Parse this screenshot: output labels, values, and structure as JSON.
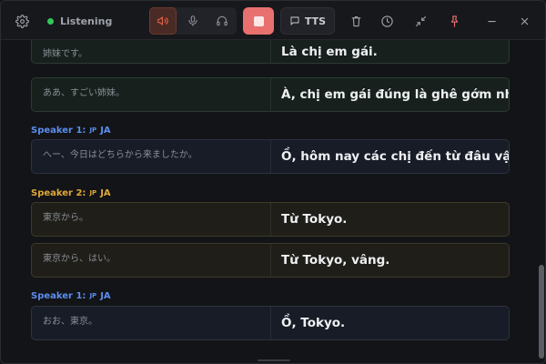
{
  "colors": {
    "accent_red": "#e8706f",
    "listening_green": "#34c759",
    "speaker1_blue": "#5b8def",
    "speaker2_amber": "#e0a83a"
  },
  "toolbar": {
    "settings_icon": "gear-icon",
    "status_label": "Listening",
    "speaker_icon": "speaker-icon",
    "mic_icon": "microphone-icon",
    "headphones_icon": "headphones-icon",
    "stop_icon": "stop-icon",
    "tts_label": "TTS",
    "trash_icon": "trash-icon",
    "clock_icon": "clock-icon",
    "minimize_icon": "collapse-icon",
    "pin_icon": "pin-icon",
    "min_icon": "minus-icon",
    "close_icon": "close-icon"
  },
  "transcript": [
    {
      "type": "row",
      "tone": "green",
      "source": "姉妹です。",
      "target": "Là chị em gái."
    },
    {
      "type": "row",
      "tone": "green",
      "source": "ああ、すごい姉妹。",
      "target": "À, chị em gái đúng là ghê gớm nhỉ."
    },
    {
      "type": "speaker",
      "tone": "blue",
      "label": "Speaker 1:",
      "flag": "JP",
      "lang": "JA"
    },
    {
      "type": "row",
      "tone": "blue",
      "source": "へー、今日はどちらから来ましたか。",
      "target": "Ồ, hôm nay các chị đến từ đâu vậy?"
    },
    {
      "type": "speaker",
      "tone": "amber",
      "label": "Speaker 2:",
      "flag": "JP",
      "lang": "JA"
    },
    {
      "type": "row",
      "tone": "amber",
      "source": "東京から。",
      "target": "Từ Tokyo."
    },
    {
      "type": "row",
      "tone": "amber",
      "source": "東京から、はい。",
      "target": "Từ Tokyo, vâng."
    },
    {
      "type": "speaker",
      "tone": "blue",
      "label": "Speaker 1:",
      "flag": "JP",
      "lang": "JA"
    },
    {
      "type": "row",
      "tone": "blue",
      "source": "おお、東京。",
      "target": "Ồ, Tokyo."
    }
  ]
}
